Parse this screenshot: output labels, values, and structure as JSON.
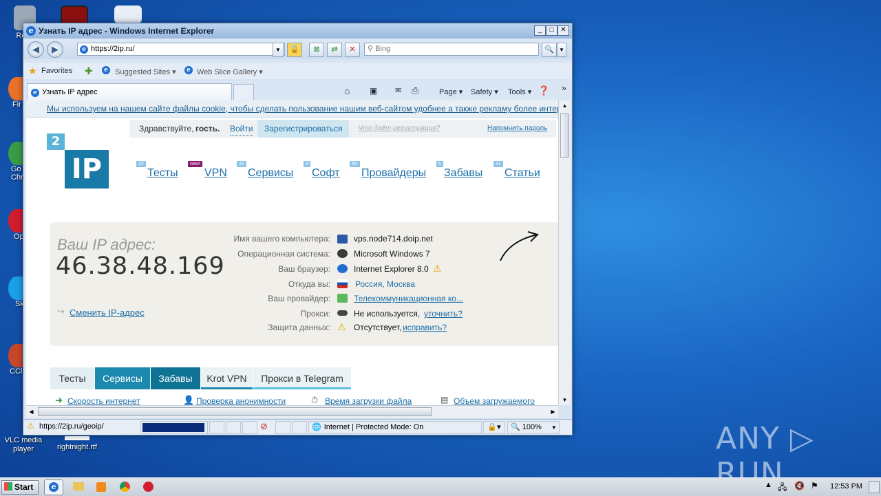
{
  "desktop": {
    "icons": [
      {
        "label": "Recy",
        "color": "#9aa8b8"
      },
      {
        "label": "Fir",
        "color": "#e8702a"
      },
      {
        "label": "Go Chr",
        "color": "#3a9b46"
      },
      {
        "label": "Op",
        "color": "#d11e2e"
      },
      {
        "label": "Sk",
        "color": "#1aa0e8"
      },
      {
        "label": "CCle",
        "color": "#c8472a"
      },
      {
        "label": "VLC media player",
        "color": "#f08a1c"
      },
      {
        "label": "rightnight.rtf",
        "color": "#ffffff"
      }
    ],
    "watermark": "ANY ▷ RUN"
  },
  "window": {
    "title": "Узнать IP адрес - Windows Internet Explorer",
    "controls": {
      "minimize": "_",
      "maximize": "□",
      "close": "✕"
    },
    "address": "https://2ip.ru/",
    "search_placeholder": "Bing",
    "favorites": {
      "label": "Favorites",
      "items": [
        "Suggested Sites ▾",
        "Web Slice Gallery ▾"
      ]
    },
    "tab_title": "Узнать IP адрес",
    "commands": [
      "Page ▾",
      "Safety ▾",
      "Tools ▾"
    ],
    "status": {
      "url": "https://2ip.ru/geoip/",
      "zone": "Internet | Protected Mode: On",
      "zoom": "100%"
    }
  },
  "page": {
    "cookie_notice": "Мы используем на нашем сайте файлы cookie, чтобы сделать пользование нашим веб-сайтом удобнее а также рекламу более интересной",
    "greeting": {
      "hello": "Здравствуйте,",
      "guest": "гость.",
      "login": "Войти",
      "register": "Зарегистрироваться",
      "why": "Что даёт регистрация?",
      "remind": "Напомнить пароль"
    },
    "logo": {
      "badge": "2",
      "main": "IP"
    },
    "nav": [
      {
        "label": "Тесты",
        "badge": "32"
      },
      {
        "label": "VPN",
        "badge": "new!"
      },
      {
        "label": "Сервисы",
        "badge": "16"
      },
      {
        "label": "Софт",
        "badge": "8"
      },
      {
        "label": "Провайдеры",
        "badge": "4K"
      },
      {
        "label": "Забавы",
        "badge": "6"
      },
      {
        "label": "Статьи",
        "badge": "31"
      }
    ],
    "ip": {
      "heading": "Ваш IP адрес:",
      "value": "46.38.48.169",
      "change": "Сменить IP-адрес"
    },
    "info": [
      {
        "label": "Имя вашего компьютера:",
        "value": "vps.node714.doip.net",
        "link": false,
        "icon_color": "#2a5aa8"
      },
      {
        "label": "Операционная система:",
        "value": "Microsoft Windows 7",
        "link": false,
        "icon_color": "#3a3a3a"
      },
      {
        "label": "Ваш браузер:",
        "value": "Internet Explorer 8.0",
        "link": false,
        "icon_color": "#1f6fd1",
        "warn": true
      },
      {
        "label": "Откуда вы:",
        "value": "Россия, Москва",
        "link": true,
        "icon_color": "#d52b1e"
      },
      {
        "label": "Ваш провайдер:",
        "value": "Телекоммуникационная ко...",
        "link": true,
        "icon_color": "#5cb85c"
      },
      {
        "label": "Прокси:",
        "value": "Не используется,",
        "extra": "уточнить?",
        "icon_color": "#444"
      },
      {
        "label": "Защита данных:",
        "value": "Отсутствует,",
        "extra": "исправить?",
        "icon_color": "#f0c419",
        "warn_icon": true
      }
    ],
    "bottom_tabs": [
      {
        "label": "Тесты",
        "active": false
      },
      {
        "label": "Сервисы",
        "active": true
      },
      {
        "label": "Забавы",
        "active": true
      },
      {
        "label": "Krot VPN",
        "active": false
      },
      {
        "label": "Прокси в Telegram",
        "active": false
      }
    ],
    "bottom_links": [
      "Скорость интернет",
      "Проверка анонимности",
      "Время загрузки файла",
      "Объем загружаемого"
    ]
  },
  "taskbar": {
    "start": "Start",
    "time": "12:53 PM"
  }
}
